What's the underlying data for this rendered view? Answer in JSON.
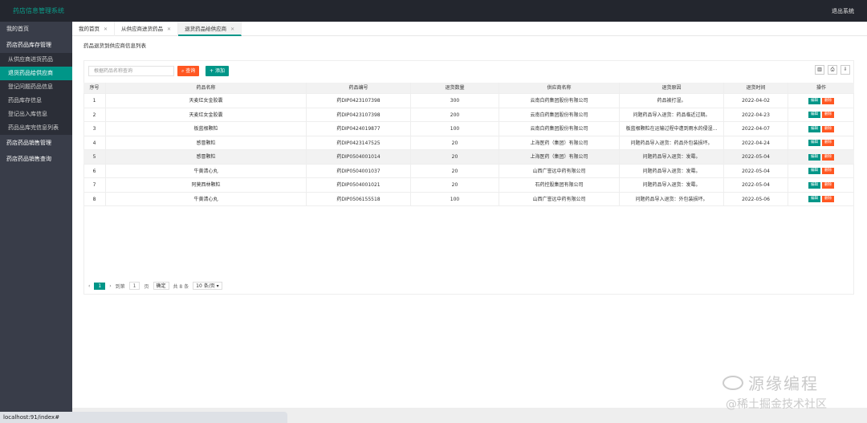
{
  "app": {
    "title": "药店信息管理系统",
    "logout": "退出系统",
    "footer": "药店信息管理系统"
  },
  "sidebar": {
    "home": "我的首页",
    "group1": "药店药品库存管理",
    "sub": [
      {
        "label": "从供应商进货药品",
        "active": false
      },
      {
        "label": "退货药品给供应商",
        "active": true
      },
      {
        "label": "登记问题药品信息",
        "active": false
      },
      {
        "label": "药品库存信息",
        "active": false
      },
      {
        "label": "登记出入库信息",
        "active": false
      },
      {
        "label": "药品出库完信息列表",
        "active": false
      }
    ],
    "group2": "药店药品销售管理",
    "group3": "药店药品销售查询"
  },
  "tabs": [
    {
      "label": "我的首页",
      "active": false
    },
    {
      "label": "从供应商进货药品",
      "active": false
    },
    {
      "label": "退货药品给供应商",
      "active": true
    }
  ],
  "page": {
    "title": "药品退货到供应商信息列表"
  },
  "toolbar": {
    "search_placeholder": "根据药品名称查询",
    "search_label": "查询",
    "add_label": "添加",
    "icons": [
      "columns-icon",
      "print-icon",
      "export-icon"
    ]
  },
  "table": {
    "columns": [
      "序号",
      "药品名称",
      "药品编号",
      "退货数量",
      "供应商名称",
      "退货原因",
      "退货时间",
      "操作"
    ],
    "rows": [
      [
        "1",
        "天麦红女金胶囊",
        "药DIP0423107398",
        "300",
        "云南白药集团股份有限公司",
        "药品被打湿。",
        "2022-04-02"
      ],
      [
        "2",
        "天麦红女金胶囊",
        "药DIP0423107398",
        "200",
        "云南白药集团股份有限公司",
        "问题药品导入退货：药品临近过期。",
        "2022-04-23"
      ],
      [
        "3",
        "板蓝根颗粒",
        "药DIP0424019877",
        "100",
        "云南白药集团股份有限公司",
        "板蓝根颗粒在运输过程中遭到雨水的侵湿...",
        "2022-04-07"
      ],
      [
        "4",
        "感冒颗粒",
        "药DIP0423147525",
        "20",
        "上海医药（集团）有限公司",
        "问题药品导入退货：药品外包装损坏。",
        "2022-04-24"
      ],
      [
        "5",
        "感冒颗粒",
        "药DIP0504001014",
        "20",
        "上海医药（集团）有限公司",
        "问题药品导入退货：发霉。",
        "2022-05-04"
      ],
      [
        "6",
        "牛黄清心丸",
        "药DIP0504001037",
        "20",
        "山西广誉远中药有限公司",
        "问题药品导入退货：发霉。",
        "2022-05-04"
      ],
      [
        "7",
        "阿莫西林颗粒",
        "药DIP0504001021",
        "20",
        "石药控股集团有限公司",
        "问题药品导入退货：发霉。",
        "2022-05-04"
      ],
      [
        "8",
        "牛黄清心丸",
        "药DIP0506155518",
        "100",
        "山西广誉远中药有限公司",
        "问题药品导入退货：外包装损坏。",
        "2022-05-06"
      ]
    ],
    "edit_label": "编辑",
    "delete_label": "删除"
  },
  "pager": {
    "current": "1",
    "goto_label": "到第",
    "page_input": "1",
    "page_unit": "页",
    "confirm": "确定",
    "total": "共 8 条",
    "size": "10 条/页"
  },
  "status_url": "localhost:91/index#",
  "watermark": {
    "line1": "源缘编程",
    "line2": "@稀土掘金技术社区"
  },
  "colors": {
    "accent": "#009688",
    "danger": "#ff5722",
    "topbar": "#23262e",
    "sidebar": "#393d49"
  }
}
